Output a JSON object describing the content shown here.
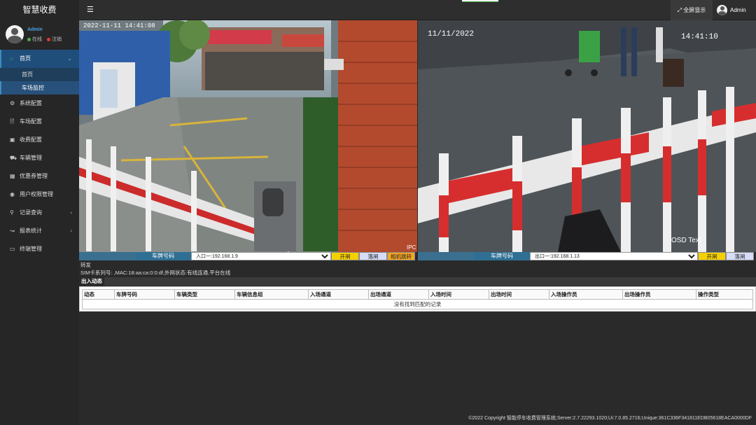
{
  "app": {
    "brand": "智慧收费"
  },
  "topbar": {
    "menu_icon": "hamburger-icon",
    "fullscreen_label": "全屏显示",
    "admin_label": "Admin"
  },
  "user": {
    "name": "Admin",
    "online_label": "在线",
    "logout_label": "注销"
  },
  "sidebar": {
    "home": {
      "label": "首页",
      "icon": "home-icon"
    },
    "sub_items": [
      {
        "label": "首页"
      },
      {
        "label": "车场监控"
      }
    ],
    "items": [
      {
        "label": "系统配置",
        "icon": "gears-icon"
      },
      {
        "label": "车场配置",
        "icon": "file-icon"
      },
      {
        "label": "收费配置",
        "icon": "money-icon"
      },
      {
        "label": "车辆管理",
        "icon": "car-icon"
      },
      {
        "label": "优惠券管理",
        "icon": "calendar-icon"
      },
      {
        "label": "用户权限管理",
        "icon": "user-circle-icon"
      },
      {
        "label": "记录查询",
        "icon": "search-icon"
      },
      {
        "label": "报表统计",
        "icon": "line-chart-icon"
      },
      {
        "label": "终端管理",
        "icon": "monitor-icon"
      }
    ]
  },
  "cameras": {
    "left": {
      "osd_date": "2022-11-11 14:41:08",
      "osd_corner": "IPC"
    },
    "right": {
      "osd_date": "11/11/2022",
      "osd_time": "14:41:10",
      "osd_text": "OSD Text"
    }
  },
  "controls": {
    "left": {
      "plate_label": "车牌号码",
      "selected": "入口一:192.168.1.9",
      "open": "开闸",
      "close": "落闸",
      "jump": "相机跳转"
    },
    "right": {
      "plate_label": "车牌号码",
      "selected": "出口一:192.168.1.13",
      "open": "开闸",
      "close": "落闸"
    }
  },
  "status": {
    "line1": "转发",
    "line2": "SIM卡系列号: ,MAC:18:aa:ca:0:0:df,外网状态:有线连通,平台在线"
  },
  "records": {
    "tab": "出入动态",
    "columns": [
      "动态",
      "车牌号码",
      "车辆类型",
      "车辆信息组",
      "入场通道",
      "出场通道",
      "入场时间",
      "出场时间",
      "入场操作员",
      "出场操作员",
      "操作类型"
    ],
    "empty": "没有找到匹配的记录"
  },
  "footer": {
    "text": "©2022 Copyright 智能停车收费管理系统;Server:2.7.22293.1020;Ui:7.0.85.2716;Unique:361C336F341811EDB05618EACA0000DF"
  }
}
